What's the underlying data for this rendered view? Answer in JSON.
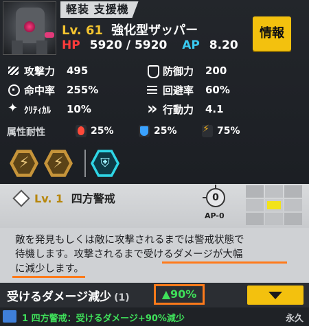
{
  "unit": {
    "class_tag": "軽装 支援機",
    "level_label": "Lv. 61",
    "name": "強化型ザッパー",
    "hp_label": "HP",
    "hp_value": "5920 / 5920",
    "ap_label": "AP",
    "ap_value": "8.20",
    "info_button": "情報"
  },
  "stats": {
    "attack": {
      "label": "攻撃力",
      "value": "495"
    },
    "defense": {
      "label": "防御力",
      "value": "200"
    },
    "accuracy": {
      "label": "命中率",
      "value": "255%"
    },
    "evasion": {
      "label": "回避率",
      "value": "60%"
    },
    "critical": {
      "label": "ｸﾘﾃｨｶﾙ",
      "value": "10%"
    },
    "action": {
      "label": "行動力",
      "value": "4.1"
    }
  },
  "resistance": {
    "label": "属性耐性",
    "fire": "25%",
    "ice": "25%",
    "electric": "75%"
  },
  "skill_icons": [
    "lightning-skill",
    "lightning-skill",
    "shield-skill"
  ],
  "selected_skill": {
    "level_label": "Lv. 1",
    "name": "四方警戒",
    "ap_cost": "0",
    "ap_label": "AP-0",
    "range_grid": [
      0,
      0,
      0,
      0,
      1,
      0,
      0,
      0,
      0
    ]
  },
  "description": {
    "line1": "敵を発見もしくは敵に攻撃されるまでは警戒状態で",
    "line2": "待機します。攻撃されるまで受けるダメージが大幅",
    "line3": "に減少します。"
  },
  "effect": {
    "name": "受けるダメージ減少",
    "count": "(1)",
    "percent": "▲90%"
  },
  "buff_line": {
    "text": "1 四方警戒：受けるダメージ+90%減少",
    "duration": "永久"
  },
  "colors": {
    "accent_yellow": "#f3c10e",
    "hp_red": "#ff3b3b",
    "ap_blue": "#39c9f0",
    "highlight_orange": "#ff7a1a",
    "buff_green": "#3fe05a"
  }
}
